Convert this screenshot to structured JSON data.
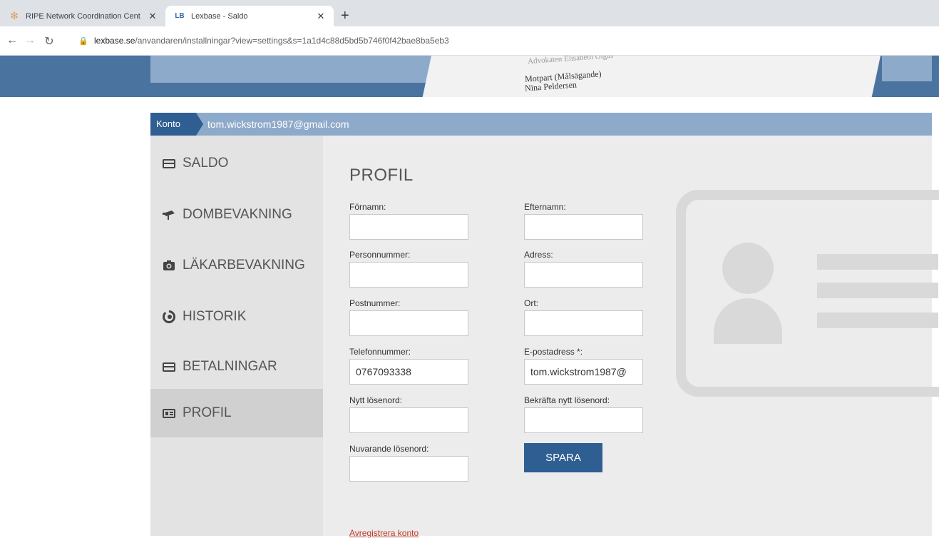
{
  "browser": {
    "tabs": [
      {
        "title": "RIPE Network Coordination Cent",
        "favicon": "ripe-icon",
        "close": "✕"
      },
      {
        "title": "Lexbase - Saldo",
        "favicon": "LB",
        "close": "✕"
      }
    ],
    "new_tab": "+",
    "url_host": "lexbase.se",
    "url_path": "/anvandaren/installningar?view=settings&s=1a1d4c88d5bd5b746f0f42bae8ba5eb3"
  },
  "banner": {
    "line1": "Advokaten Elisabeth Olgas",
    "line2": "Motpart (Målsägande)",
    "line3": "Nina Peldersen"
  },
  "account": {
    "label": "Konto",
    "email": "tom.wickstrom1987@gmail.com"
  },
  "sidebar": {
    "items": [
      {
        "label": "SALDO",
        "icon": "credit-card-icon"
      },
      {
        "label": "DOMBEVAKNING",
        "icon": "camera-icon"
      },
      {
        "label": "LÄKARBEVAKNING",
        "icon": "medical-camera-icon"
      },
      {
        "label": "HISTORIK",
        "icon": "history-icon"
      },
      {
        "label": "BETALNINGAR",
        "icon": "credit-card-icon"
      },
      {
        "label": "PROFIL",
        "icon": "id-card-icon",
        "active": true
      }
    ]
  },
  "profile": {
    "title": "PROFIL",
    "fields": {
      "fornamn": {
        "label": "Förnamn:",
        "value": ""
      },
      "efternamn": {
        "label": "Efternamn:",
        "value": ""
      },
      "personnummer": {
        "label": "Personnummer:",
        "value": ""
      },
      "adress": {
        "label": "Adress:",
        "value": ""
      },
      "postnummer": {
        "label": "Postnummer:",
        "value": ""
      },
      "ort": {
        "label": "Ort:",
        "value": ""
      },
      "telefon": {
        "label": "Telefonnummer:",
        "value": "0767093338"
      },
      "epost": {
        "label": "E-postadress *:",
        "value": "tom.wickstrom1987@"
      },
      "nytt_losenord": {
        "label": "Nytt lösenord:",
        "value": ""
      },
      "bekrafta_losenord": {
        "label": "Bekräfta nytt lösenord:",
        "value": ""
      },
      "nuvarande_losenord": {
        "label": "Nuvarande lösenord:",
        "value": ""
      }
    },
    "save_label": "SPARA",
    "unregister_label": "Avregistrera konto"
  }
}
